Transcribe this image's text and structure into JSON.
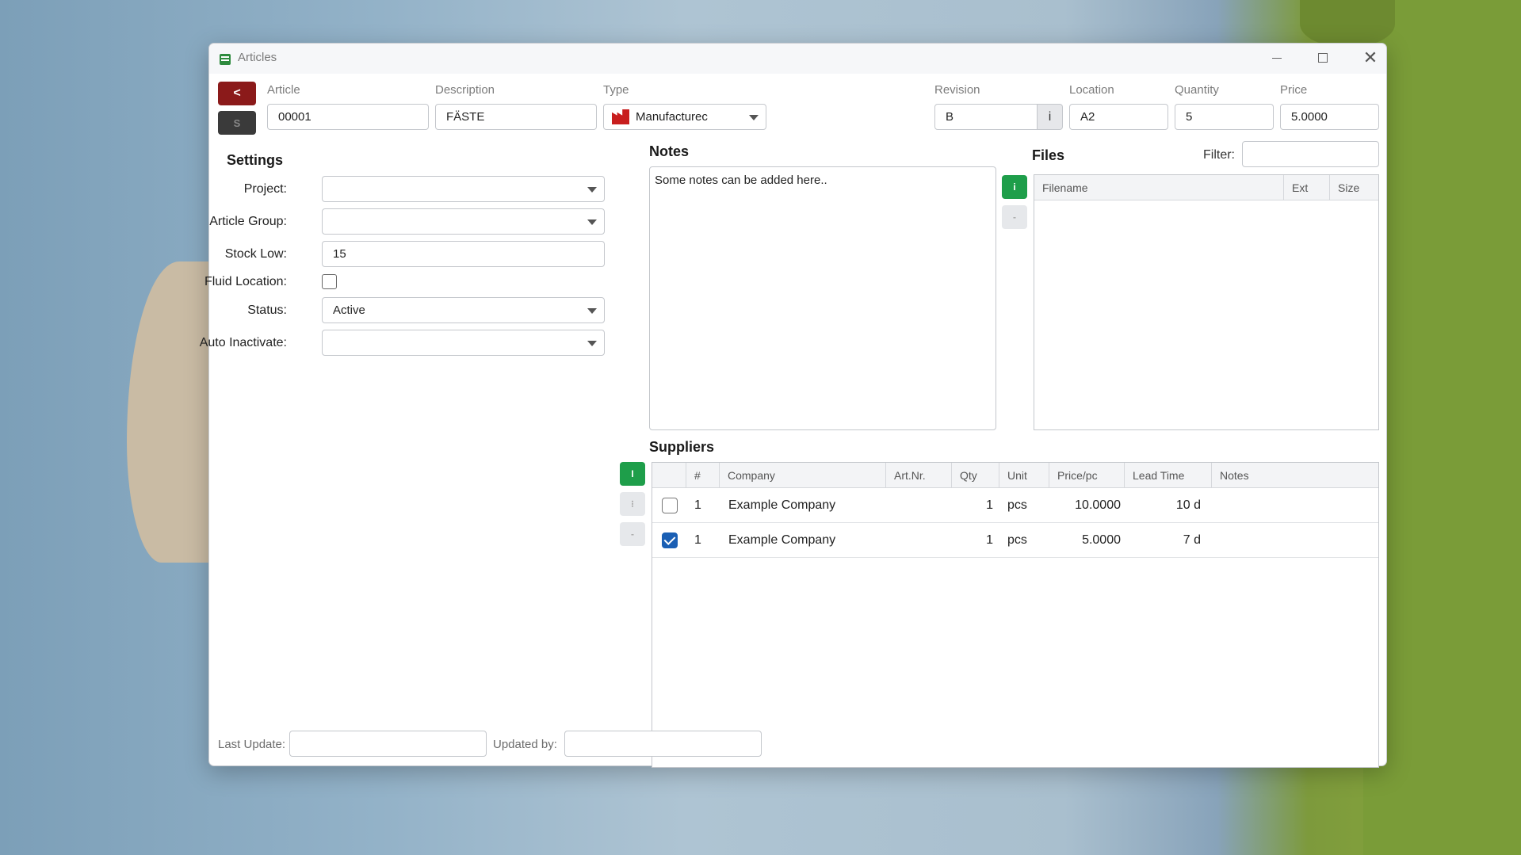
{
  "window": {
    "title": "Articles"
  },
  "header": {
    "back_label": "<",
    "save_label": "S",
    "article": {
      "label": "Article",
      "value": "00001"
    },
    "description": {
      "label": "Description",
      "value": "FÄSTE"
    },
    "type": {
      "label": "Type",
      "value": "Manufacturec"
    },
    "revision": {
      "label": "Revision",
      "value": "B",
      "info_label": "i"
    },
    "location": {
      "label": "Location",
      "value": "A2"
    },
    "quantity": {
      "label": "Quantity",
      "value": "5"
    },
    "price": {
      "label": "Price",
      "value": "5.0000"
    }
  },
  "settings": {
    "title": "Settings",
    "project": {
      "label": "Project:",
      "value": ""
    },
    "article_group": {
      "label": "Article Group:",
      "value": ""
    },
    "stock_low": {
      "label": "Stock Low:",
      "value": "15"
    },
    "fluid_location": {
      "label": "Fluid Location:",
      "checked": false
    },
    "status": {
      "label": "Status:",
      "value": "Active"
    },
    "auto_inactivate": {
      "label": "Auto Inactivate:",
      "value": ""
    }
  },
  "notes": {
    "title": "Notes",
    "text": "Some notes can be added here.."
  },
  "files": {
    "title": "Files",
    "filter_label": "Filter:",
    "filter_value": "",
    "add_label": "i",
    "remove_label": "-",
    "columns": [
      "Filename",
      "Ext",
      "Size"
    ],
    "rows": []
  },
  "suppliers": {
    "title": "Suppliers",
    "add_label": "I",
    "edit_label": "⁝",
    "remove_label": "-",
    "columns": [
      "#",
      "Company",
      "Art.Nr.",
      "Qty",
      "Unit",
      "Price/pc",
      "Lead Time",
      "Notes"
    ],
    "rows": [
      {
        "checked": false,
        "num": "1",
        "company": "Example Company",
        "art_nr": "",
        "qty": "1",
        "unit": "pcs",
        "price": "10.0000",
        "lead_time": "10 d",
        "notes": ""
      },
      {
        "checked": true,
        "num": "1",
        "company": "Example Company",
        "art_nr": "",
        "qty": "1",
        "unit": "pcs",
        "price": "5.0000",
        "lead_time": "7 d",
        "notes": ""
      }
    ]
  },
  "footer": {
    "last_update": {
      "label": "Last Update:",
      "value": ""
    },
    "updated_by": {
      "label": "Updated by:",
      "value": ""
    }
  },
  "colors": {
    "accent_green": "#1e9e4a",
    "back_red": "#8b1a1a",
    "checkbox_blue": "#1a5fb4"
  }
}
